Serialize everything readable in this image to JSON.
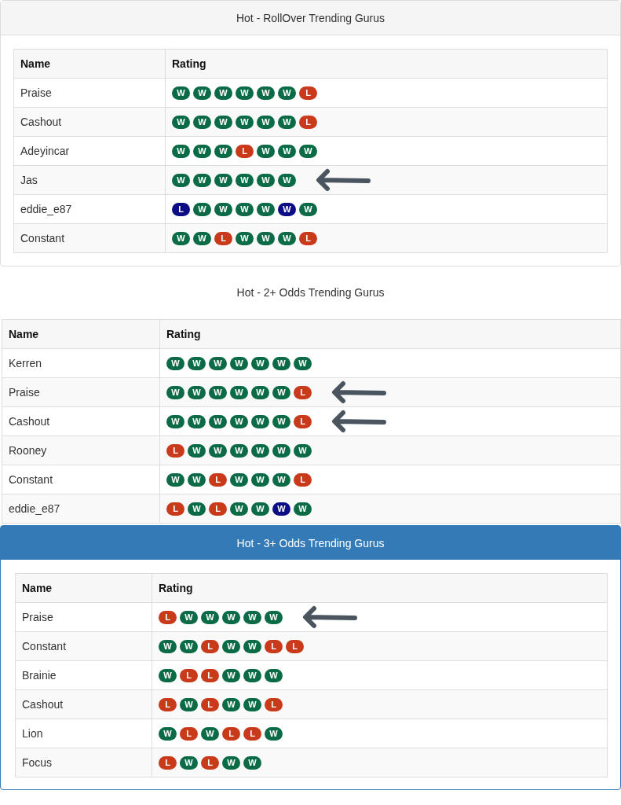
{
  "panels": [
    {
      "kind": "default",
      "title": "Hot - RollOver Trending Gurus",
      "columns": [
        "Name",
        "Rating"
      ],
      "rows": [
        {
          "name": "Praise",
          "marked": false,
          "rating": [
            {
              "t": "W",
              "color": "#0b6b47"
            },
            {
              "t": "W",
              "color": "#0b6b47"
            },
            {
              "t": "W",
              "color": "#0b6b47"
            },
            {
              "t": "W",
              "color": "#0b6b47"
            },
            {
              "t": "W",
              "color": "#0b6b47"
            },
            {
              "t": "W",
              "color": "#0b6b47"
            },
            {
              "t": "L",
              "color": "#c93a1b"
            }
          ]
        },
        {
          "name": "Cashout",
          "marked": false,
          "rating": [
            {
              "t": "W",
              "color": "#0b6b47"
            },
            {
              "t": "W",
              "color": "#0b6b47"
            },
            {
              "t": "W",
              "color": "#0b6b47"
            },
            {
              "t": "W",
              "color": "#0b6b47"
            },
            {
              "t": "W",
              "color": "#0b6b47"
            },
            {
              "t": "W",
              "color": "#0b6b47"
            },
            {
              "t": "L",
              "color": "#c93a1b"
            }
          ]
        },
        {
          "name": "Adeyincar",
          "marked": false,
          "rating": [
            {
              "t": "W",
              "color": "#0b6b47"
            },
            {
              "t": "W",
              "color": "#0b6b47"
            },
            {
              "t": "W",
              "color": "#0b6b47"
            },
            {
              "t": "L",
              "color": "#c93a1b"
            },
            {
              "t": "W",
              "color": "#0b6b47"
            },
            {
              "t": "W",
              "color": "#0b6b47"
            },
            {
              "t": "W",
              "color": "#0b6b47"
            }
          ]
        },
        {
          "name": "Jas",
          "marked": true,
          "rating": [
            {
              "t": "W",
              "color": "#0b6b47"
            },
            {
              "t": "W",
              "color": "#0b6b47"
            },
            {
              "t": "W",
              "color": "#0b6b47"
            },
            {
              "t": "W",
              "color": "#0b6b47"
            },
            {
              "t": "W",
              "color": "#0b6b47"
            },
            {
              "t": "W",
              "color": "#0b6b47"
            }
          ]
        },
        {
          "name": "eddie_e87",
          "marked": false,
          "rating": [
            {
              "t": "L",
              "color": "#0c0c85"
            },
            {
              "t": "W",
              "color": "#0b6b47"
            },
            {
              "t": "W",
              "color": "#0b6b47"
            },
            {
              "t": "W",
              "color": "#0b6b47"
            },
            {
              "t": "W",
              "color": "#0b6b47"
            },
            {
              "t": "W",
              "color": "#0c0c85"
            },
            {
              "t": "W",
              "color": "#0b6b47"
            }
          ]
        },
        {
          "name": "Constant",
          "marked": false,
          "rating": [
            {
              "t": "W",
              "color": "#0b6b47"
            },
            {
              "t": "W",
              "color": "#0b6b47"
            },
            {
              "t": "L",
              "color": "#c93a1b"
            },
            {
              "t": "W",
              "color": "#0b6b47"
            },
            {
              "t": "W",
              "color": "#0b6b47"
            },
            {
              "t": "W",
              "color": "#0b6b47"
            },
            {
              "t": "L",
              "color": "#c93a1b"
            }
          ]
        }
      ]
    },
    {
      "kind": "plain",
      "title": "Hot - 2+ Odds Trending Gurus",
      "columns": [
        "Name",
        "Rating"
      ],
      "rows": [
        {
          "name": "Kerren",
          "marked": false,
          "rating": [
            {
              "t": "W",
              "color": "#0b6b47"
            },
            {
              "t": "W",
              "color": "#0b6b47"
            },
            {
              "t": "W",
              "color": "#0b6b47"
            },
            {
              "t": "W",
              "color": "#0b6b47"
            },
            {
              "t": "W",
              "color": "#0b6b47"
            },
            {
              "t": "W",
              "color": "#0b6b47"
            },
            {
              "t": "W",
              "color": "#0b6b47"
            }
          ]
        },
        {
          "name": "Praise",
          "marked": true,
          "rating": [
            {
              "t": "W",
              "color": "#0b6b47"
            },
            {
              "t": "W",
              "color": "#0b6b47"
            },
            {
              "t": "W",
              "color": "#0b6b47"
            },
            {
              "t": "W",
              "color": "#0b6b47"
            },
            {
              "t": "W",
              "color": "#0b6b47"
            },
            {
              "t": "W",
              "color": "#0b6b47"
            },
            {
              "t": "L",
              "color": "#c93a1b"
            }
          ]
        },
        {
          "name": "Cashout",
          "marked": true,
          "rating": [
            {
              "t": "W",
              "color": "#0b6b47"
            },
            {
              "t": "W",
              "color": "#0b6b47"
            },
            {
              "t": "W",
              "color": "#0b6b47"
            },
            {
              "t": "W",
              "color": "#0b6b47"
            },
            {
              "t": "W",
              "color": "#0b6b47"
            },
            {
              "t": "W",
              "color": "#0b6b47"
            },
            {
              "t": "L",
              "color": "#c93a1b"
            }
          ]
        },
        {
          "name": "Rooney",
          "marked": false,
          "rating": [
            {
              "t": "L",
              "color": "#c93a1b"
            },
            {
              "t": "W",
              "color": "#0b6b47"
            },
            {
              "t": "W",
              "color": "#0b6b47"
            },
            {
              "t": "W",
              "color": "#0b6b47"
            },
            {
              "t": "W",
              "color": "#0b6b47"
            },
            {
              "t": "W",
              "color": "#0b6b47"
            },
            {
              "t": "W",
              "color": "#0b6b47"
            }
          ]
        },
        {
          "name": "Constant",
          "marked": false,
          "rating": [
            {
              "t": "W",
              "color": "#0b6b47"
            },
            {
              "t": "W",
              "color": "#0b6b47"
            },
            {
              "t": "L",
              "color": "#c93a1b"
            },
            {
              "t": "W",
              "color": "#0b6b47"
            },
            {
              "t": "W",
              "color": "#0b6b47"
            },
            {
              "t": "W",
              "color": "#0b6b47"
            },
            {
              "t": "L",
              "color": "#c93a1b"
            }
          ]
        },
        {
          "name": "eddie_e87",
          "marked": false,
          "rating": [
            {
              "t": "L",
              "color": "#c93a1b"
            },
            {
              "t": "W",
              "color": "#0b6b47"
            },
            {
              "t": "L",
              "color": "#c93a1b"
            },
            {
              "t": "W",
              "color": "#0b6b47"
            },
            {
              "t": "W",
              "color": "#0b6b47"
            },
            {
              "t": "W",
              "color": "#0c0c85"
            },
            {
              "t": "W",
              "color": "#0b6b47"
            }
          ]
        }
      ]
    },
    {
      "kind": "primary",
      "title": "Hot - 3+ Odds Trending Gurus",
      "columns": [
        "Name",
        "Rating"
      ],
      "rows": [
        {
          "name": "Praise",
          "marked": true,
          "rating": [
            {
              "t": "L",
              "color": "#c93a1b"
            },
            {
              "t": "W",
              "color": "#0b6b47"
            },
            {
              "t": "W",
              "color": "#0b6b47"
            },
            {
              "t": "W",
              "color": "#0b6b47"
            },
            {
              "t": "W",
              "color": "#0b6b47"
            },
            {
              "t": "W",
              "color": "#0b6b47"
            }
          ]
        },
        {
          "name": "Constant",
          "marked": false,
          "rating": [
            {
              "t": "W",
              "color": "#0b6b47"
            },
            {
              "t": "W",
              "color": "#0b6b47"
            },
            {
              "t": "L",
              "color": "#c93a1b"
            },
            {
              "t": "W",
              "color": "#0b6b47"
            },
            {
              "t": "W",
              "color": "#0b6b47"
            },
            {
              "t": "L",
              "color": "#c93a1b"
            },
            {
              "t": "L",
              "color": "#c93a1b"
            }
          ]
        },
        {
          "name": "Brainie",
          "marked": false,
          "rating": [
            {
              "t": "W",
              "color": "#0b6b47"
            },
            {
              "t": "L",
              "color": "#c93a1b"
            },
            {
              "t": "L",
              "color": "#c93a1b"
            },
            {
              "t": "W",
              "color": "#0b6b47"
            },
            {
              "t": "W",
              "color": "#0b6b47"
            },
            {
              "t": "W",
              "color": "#0b6b47"
            }
          ]
        },
        {
          "name": "Cashout",
          "marked": false,
          "rating": [
            {
              "t": "L",
              "color": "#c93a1b"
            },
            {
              "t": "W",
              "color": "#0b6b47"
            },
            {
              "t": "L",
              "color": "#c93a1b"
            },
            {
              "t": "W",
              "color": "#0b6b47"
            },
            {
              "t": "W",
              "color": "#0b6b47"
            },
            {
              "t": "L",
              "color": "#c93a1b"
            }
          ]
        },
        {
          "name": "Lion",
          "marked": false,
          "rating": [
            {
              "t": "W",
              "color": "#0b6b47"
            },
            {
              "t": "L",
              "color": "#c93a1b"
            },
            {
              "t": "W",
              "color": "#0b6b47"
            },
            {
              "t": "L",
              "color": "#c93a1b"
            },
            {
              "t": "L",
              "color": "#c93a1b"
            },
            {
              "t": "W",
              "color": "#0b6b47"
            }
          ]
        },
        {
          "name": "Focus",
          "marked": false,
          "rating": [
            {
              "t": "L",
              "color": "#c93a1b"
            },
            {
              "t": "W",
              "color": "#0b6b47"
            },
            {
              "t": "L",
              "color": "#c93a1b"
            },
            {
              "t": "W",
              "color": "#0b6b47"
            },
            {
              "t": "W",
              "color": "#0b6b47"
            }
          ]
        }
      ]
    }
  ]
}
